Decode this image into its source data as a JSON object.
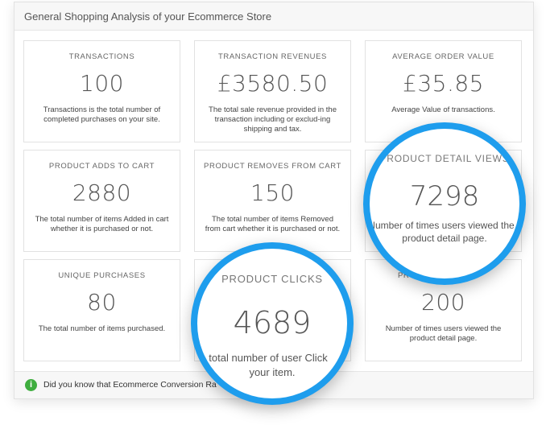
{
  "header": {
    "title": "General Shopping Analysis of your Ecommerce Store"
  },
  "cards": [
    {
      "title": "TRANSACTIONS",
      "value": "100",
      "desc": "Transactions is the total number of completed purchases on your site."
    },
    {
      "title": "TRANSACTION REVENUES",
      "value": "£3580.50",
      "desc": "The total sale revenue provided in the transaction including or exclud-ing shipping and tax."
    },
    {
      "title": "AVERAGE ORDER VALUE",
      "value": "£35.85",
      "desc": "Average Value of transactions."
    },
    {
      "title": "PRODUCT ADDS TO CART",
      "value": "2880",
      "desc": "The total number of items Added in cart whether it is purchased or not."
    },
    {
      "title": "PRODUCT REMOVES FROM CART",
      "value": "150",
      "desc": "The total number of items Removed from cart whether it is purchased or not."
    },
    {
      "title": "",
      "value": "",
      "desc": ""
    },
    {
      "title": "UNIQUE PURCHASES",
      "value": "80",
      "desc": "The total number of items purchased."
    },
    {
      "title": "",
      "value": "",
      "desc": ""
    },
    {
      "title": "PR",
      "value": "200",
      "desc": "Number of times users viewed the product detail page."
    }
  ],
  "bubbles": {
    "detail_views": {
      "title": "PRODUCT DETAIL VIEWS",
      "value": "7298",
      "desc_line1": "Number of times users viewed the",
      "desc_line2": "product detail page."
    },
    "product_clicks": {
      "title": "PRODUCT CLICKS",
      "value": "4689",
      "desc_line1": "total number of user Click",
      "desc_line2": "your item."
    }
  },
  "footer": {
    "text": "Did you know that Ecommerce Conversion Ra",
    "info_icon": "info-icon"
  },
  "colors": {
    "accent": "#1e9ded",
    "info": "#3fae3f"
  }
}
